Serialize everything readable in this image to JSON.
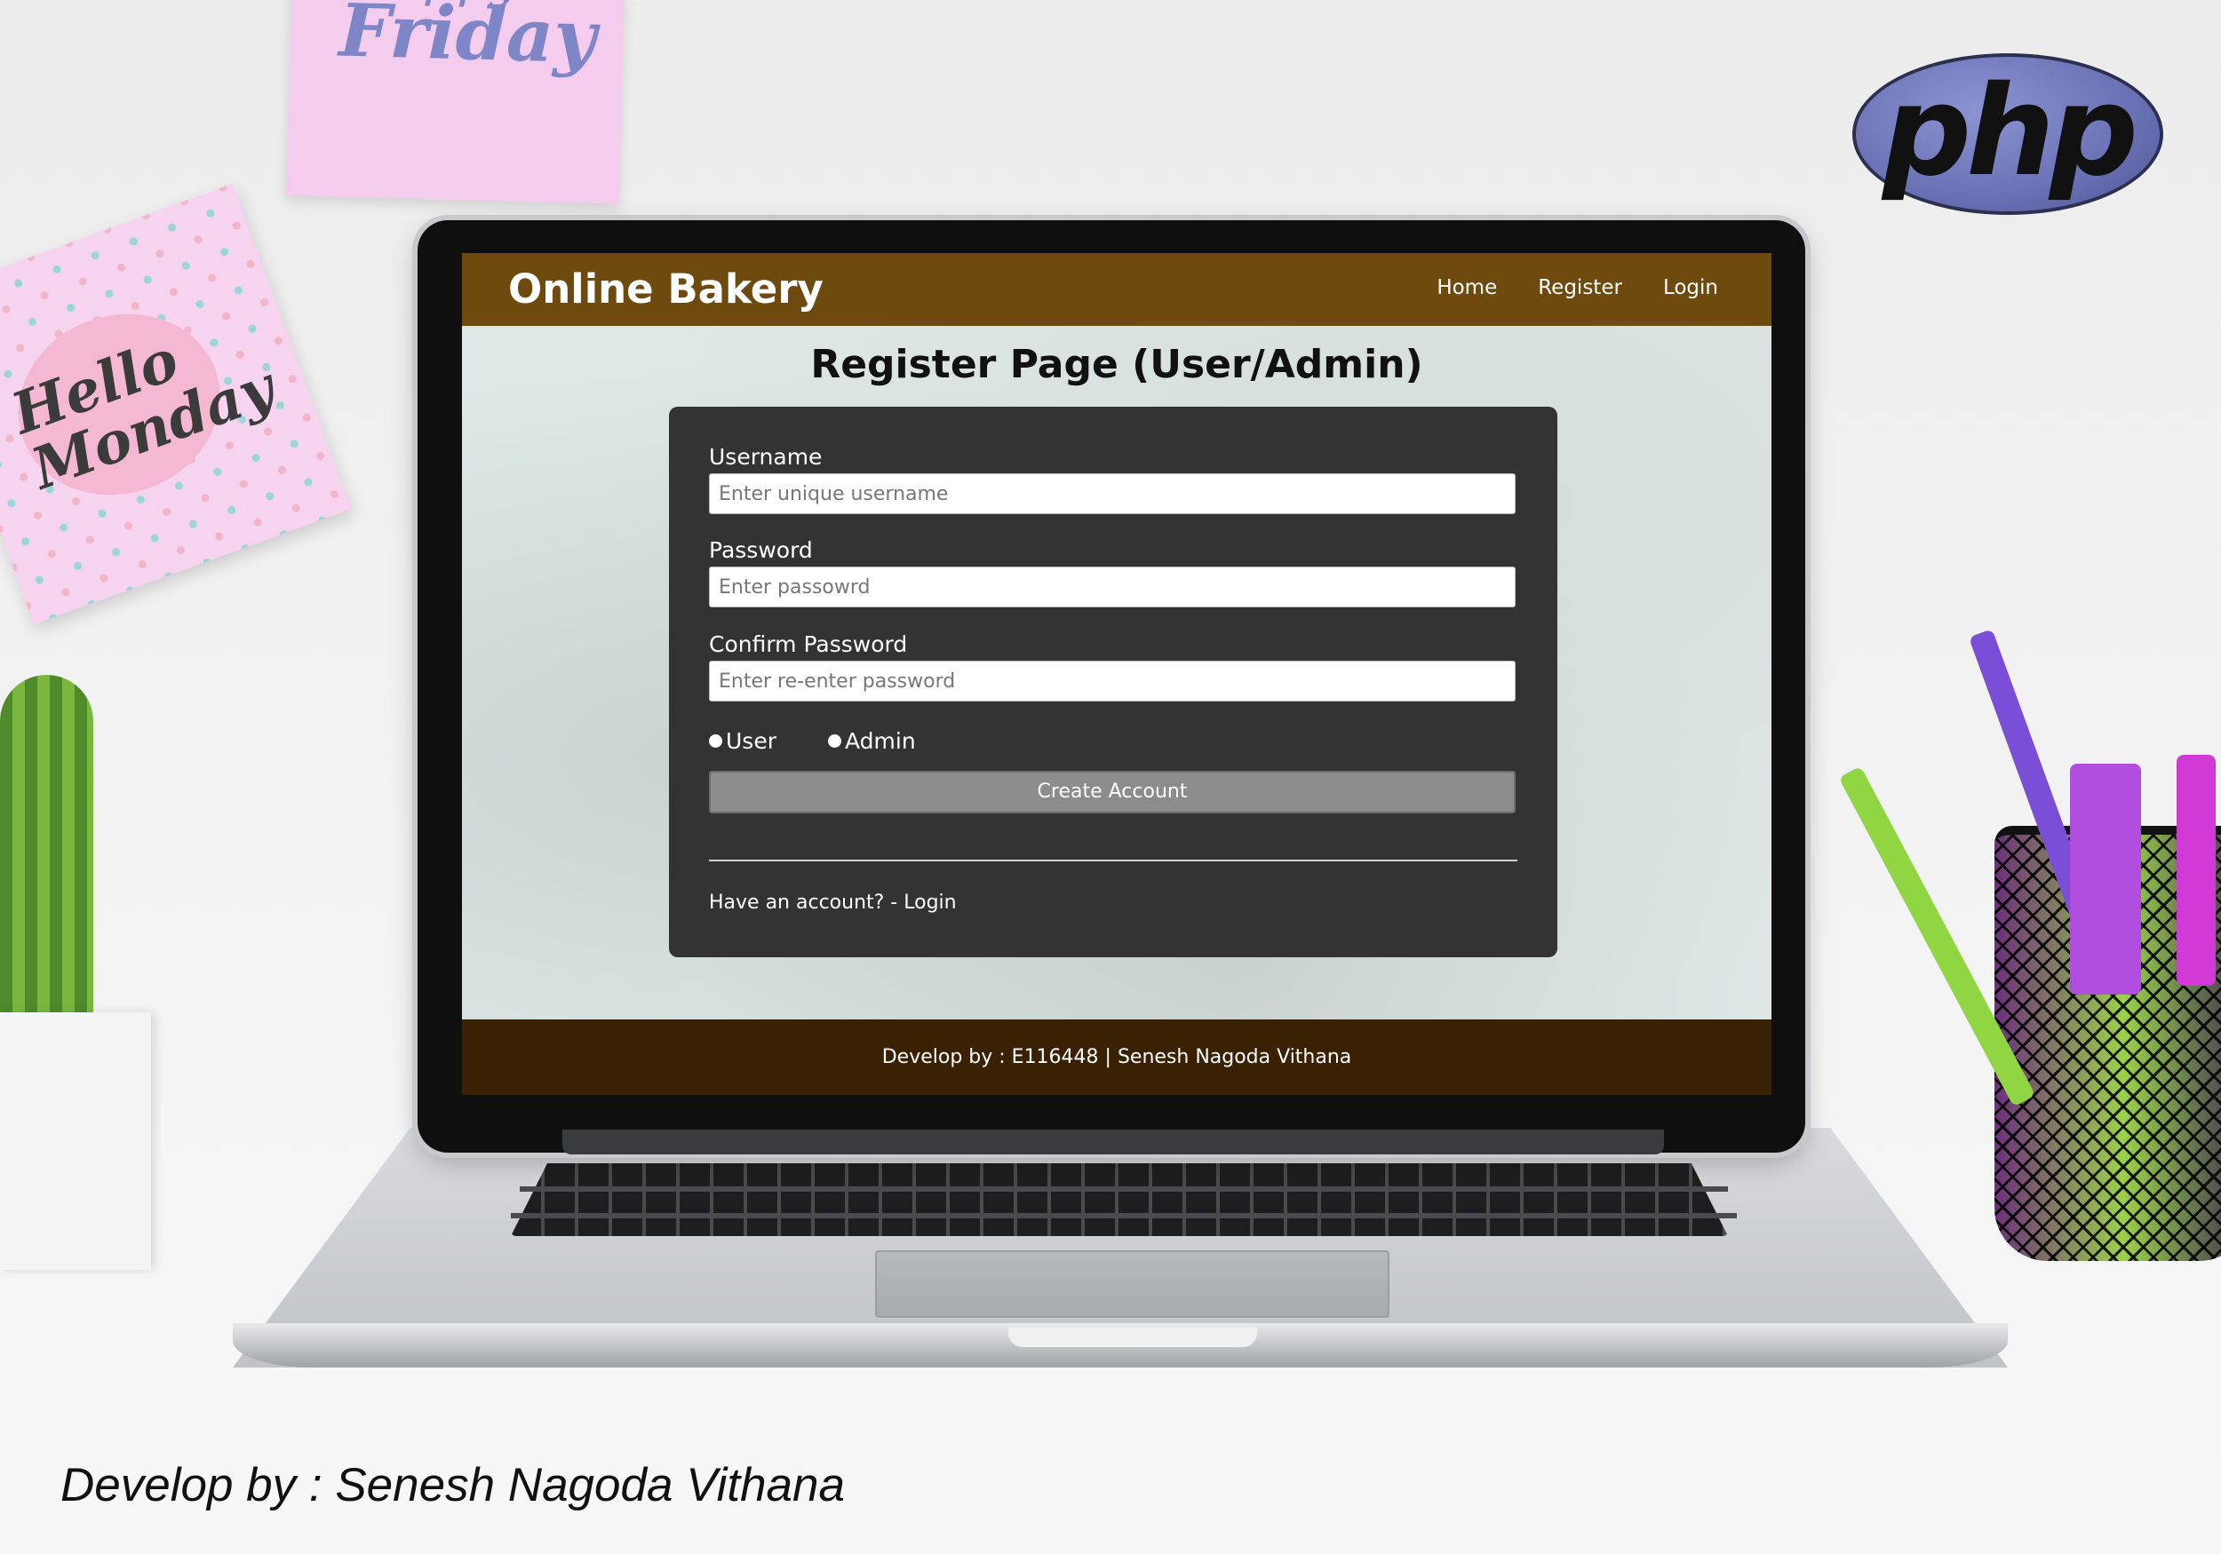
{
  "decor": {
    "note_top_text": "Happy",
    "note_friday_text": "Friday",
    "note_monday_text": "Hello Monday",
    "php_logo_text": "php"
  },
  "app": {
    "brand": "Online Bakery",
    "nav": [
      {
        "label": "Home"
      },
      {
        "label": "Register"
      },
      {
        "label": "Login"
      }
    ],
    "page_title": "Register Page (User/Admin)",
    "form": {
      "username_label": "Username",
      "username_placeholder": "Enter unique username",
      "password_label": "Password",
      "password_placeholder": "Enter passowrd",
      "confirm_label": "Confirm Password",
      "confirm_placeholder": "Enter re-enter password",
      "role_user": "User",
      "role_admin": "Admin",
      "submit_label": "Create Account",
      "have_account_text": "Have an account? - Login"
    },
    "footer_text": "Develop by : E116448 | Senesh Nagoda Vithana"
  },
  "credit_text": "Develop by : Senesh Nagoda Vithana",
  "colors": {
    "navbar": "#6e4a0f",
    "footer": "#3b2104",
    "card": "#333333",
    "button": "#8c8c8c"
  }
}
